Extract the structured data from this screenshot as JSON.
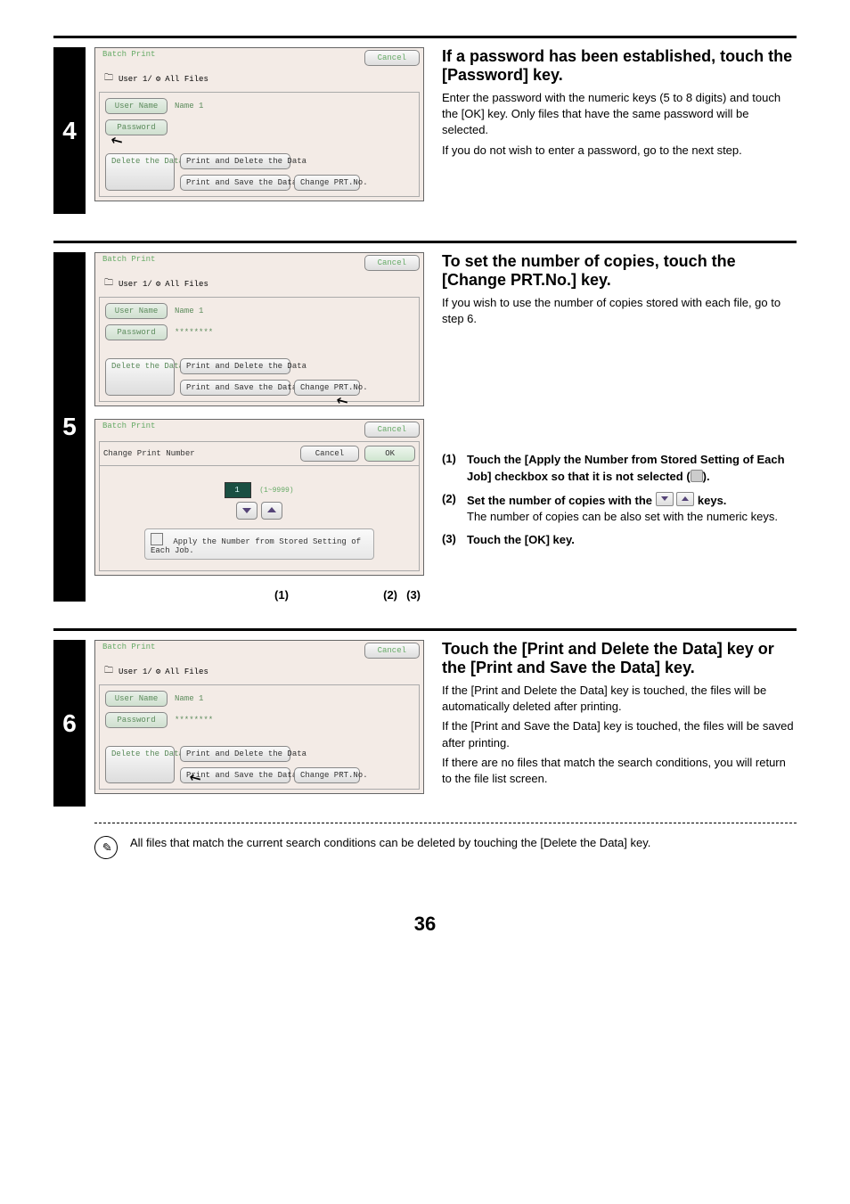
{
  "page_number": "36",
  "step4": {
    "num": "4",
    "title": "If a password has been established, touch the [Password] key.",
    "para1": "Enter the password with the numeric keys (5 to 8 digits) and touch the [OK] key. Only files that have the same password will be selected.",
    "para2": "If you do not wish to enter a password, go to the next step.",
    "dlg": {
      "title": "Batch Print",
      "cancel": "Cancel",
      "crumb1": "User 1/",
      "crumb2": "All Files",
      "user_label": "User Name",
      "user_val": "Name 1",
      "pwd_label": "Password",
      "pwd_val": "",
      "delete": "Delete the Data",
      "print_del": "Print and Delete the Data",
      "print_save": "Print and Save the Data",
      "change": "Change PRT.No."
    }
  },
  "step5": {
    "num": "5",
    "title": "To set the number of copies, touch the [Change PRT.No.] key.",
    "para1": "If you wish to use the number of copies stored with each file, go to step 6.",
    "dlgA": {
      "title": "Batch Print",
      "cancel": "Cancel",
      "crumb1": "User 1/",
      "crumb2": "All Files",
      "user_label": "User Name",
      "user_val": "Name 1",
      "pwd_label": "Password",
      "pwd_val": "********",
      "delete": "Delete the Data",
      "print_del": "Print and Delete the Data",
      "print_save": "Print and Save the Data",
      "change": "Change PRT.No."
    },
    "dlgB": {
      "title": "Batch Print",
      "cancel": "Cancel",
      "sub_title": "Change Print Number",
      "sub_cancel": "Cancel",
      "ok": "OK",
      "num": "1",
      "range": "(1~9999)",
      "apply": "Apply the Number from Stored Setting of Each Job."
    },
    "callout1": "(1)",
    "callout2": "(2)",
    "callout3": "(3)",
    "sub1_num": "(1)",
    "sub1_title_a": "Touch the [Apply the Number from Stored Setting of Each Job] checkbox so that it is not selected (",
    "sub1_title_b": ").",
    "sub2_num": "(2)",
    "sub2_title_a": "Set the number of copies with the ",
    "sub2_title_b": " keys.",
    "sub2_text": "The number of copies can be also set with the numeric keys.",
    "sub3_num": "(3)",
    "sub3_title": "Touch the [OK] key."
  },
  "step6": {
    "num": "6",
    "title": "Touch the [Print and Delete the Data] key or the [Print and Save the Data] key.",
    "para1": "If the [Print and Delete the Data] key is touched, the files will be automatically deleted after printing.",
    "para2": "If the [Print and Save the Data] key is touched, the files will be saved after printing.",
    "para3": "If there are no files that match the search conditions, you will return to the file list screen.",
    "dlg": {
      "title": "Batch Print",
      "cancel": "Cancel",
      "crumb1": "User 1/",
      "crumb2": "All Files",
      "user_label": "User Name",
      "user_val": "Name 1",
      "pwd_label": "Password",
      "pwd_val": "********",
      "delete": "Delete the Data",
      "print_del": "Print and Delete the Data",
      "print_save": "Print and Save the Data",
      "change": "Change PRT.No."
    },
    "note": "All files that match the current search conditions can be deleted by touching the [Delete the Data] key."
  }
}
